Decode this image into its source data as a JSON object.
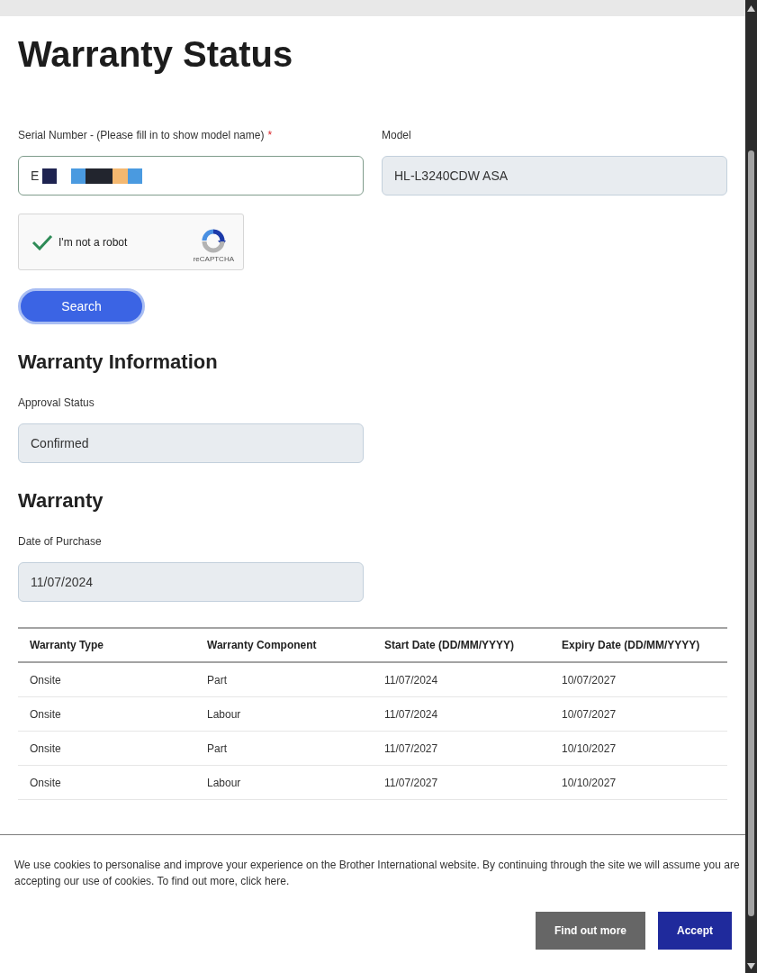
{
  "page": {
    "title": "Warranty Status"
  },
  "serial_field": {
    "label": "Serial Number - (Please fill in to show model name)",
    "required_mark": "*",
    "value": "E",
    "readonly": false,
    "redacted": true
  },
  "model_field": {
    "label": "Model",
    "value": "HL-L3240CDW ASA",
    "readonly": true
  },
  "captcha": {
    "label": "I'm not a robot",
    "checked": true,
    "brand": "reCAPTCHA"
  },
  "search_button": {
    "label": "Search",
    "focused": true
  },
  "warranty_information": {
    "heading": "Warranty Information",
    "fields": [
      {
        "label": "Approval Status",
        "value": "Confirmed",
        "readonly": true
      }
    ]
  },
  "warranty": {
    "heading": "Warranty",
    "fields": [
      {
        "label": "Date of Purchase",
        "value": "11/07/2024",
        "readonly": true
      }
    ],
    "table": {
      "columns": [
        "Warranty Type",
        "Warranty Component",
        "Start Date (DD/MM/YYYY)",
        "Expiry Date (DD/MM/YYYY)"
      ],
      "rows": [
        [
          "Onsite",
          "Part",
          "11/07/2024",
          "10/07/2027"
        ],
        [
          "Onsite",
          "Labour",
          "11/07/2024",
          "10/07/2027"
        ],
        [
          "Onsite",
          "Part",
          "11/07/2027",
          "10/10/2027"
        ],
        [
          "Onsite",
          "Labour",
          "11/07/2027",
          "10/10/2027"
        ]
      ]
    }
  },
  "cookie_banner": {
    "text": "We use cookies to personalise and improve your experience on the Brother International website. By continuing through the site we will assume you are accepting our use of cookies. To find out more, click here.",
    "buttons": [
      {
        "label": "Find out more",
        "kind": "secondary"
      },
      {
        "label": "Accept",
        "kind": "primary"
      }
    ]
  }
}
